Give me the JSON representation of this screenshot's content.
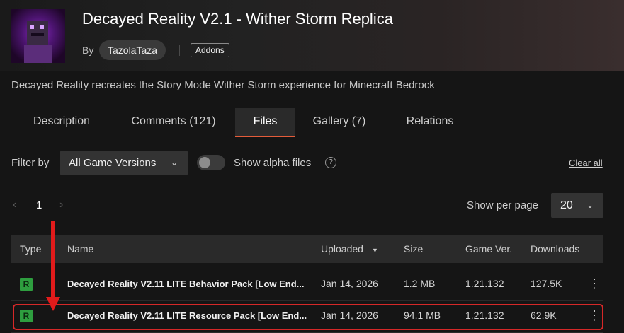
{
  "project": {
    "title": "Decayed Reality V2.1 - Wither Storm Replica",
    "by_label": "By",
    "author": "TazolaTaza",
    "category_tag": "Addons",
    "summary": "Decayed Reality recreates the Story Mode Wither Storm experience for Minecraft Bedrock"
  },
  "tabs": [
    {
      "label": "Description",
      "active": false
    },
    {
      "label": "Comments (121)",
      "active": false
    },
    {
      "label": "Files",
      "active": true
    },
    {
      "label": "Gallery (7)",
      "active": false
    },
    {
      "label": "Relations",
      "active": false
    }
  ],
  "filters": {
    "filter_label": "Filter by",
    "game_version_selected": "All Game Versions",
    "alpha_toggle_label": "Show alpha files",
    "alpha_toggle_on": false,
    "help_icon": "question-icon",
    "clear_all": "Clear all"
  },
  "pagination": {
    "current_page": "1",
    "per_page_label": "Show per page",
    "per_page_value": "20"
  },
  "table": {
    "headers": {
      "type": "Type",
      "name": "Name",
      "uploaded": "Uploaded",
      "size": "Size",
      "game_ver": "Game Ver.",
      "downloads": "Downloads"
    },
    "rows": [
      {
        "type": "R",
        "name": "Decayed Reality V2.11 LITE Behavior Pack [Low End...",
        "uploaded": "Jan 14, 2026",
        "size": "1.2 MB",
        "game_ver": "1.21.132",
        "downloads": "127.5K"
      },
      {
        "type": "R",
        "name": "Decayed Reality V2.11 LITE Resource Pack [Low End...",
        "uploaded": "Jan 14, 2026",
        "size": "94.1 MB",
        "game_ver": "1.21.132",
        "downloads": "62.9K"
      }
    ]
  },
  "colors": {
    "accent": "#e45c3a",
    "release_badge": "#2e9e3f",
    "annotation": "#e11b1b"
  }
}
